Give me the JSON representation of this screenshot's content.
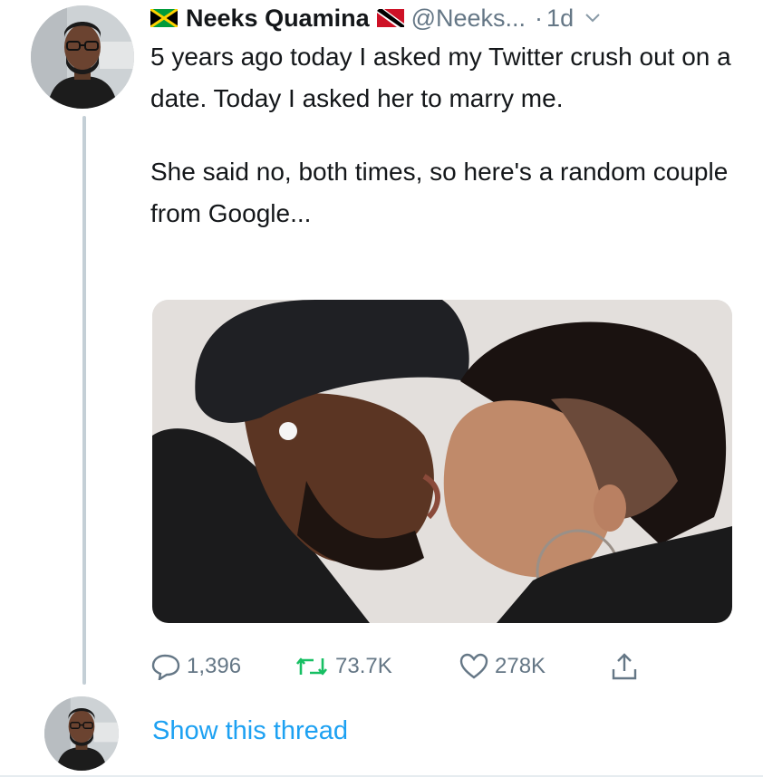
{
  "tweet": {
    "author_name": "Neeks Quamina",
    "handle": "@Neeks...",
    "dot": "·",
    "time": "1d",
    "paragraphs": [
      "5 years ago today I asked my Twitter crush out on a date. Today I asked her to marry me.",
      "She said no, both times, so here's a random couple from Google..."
    ],
    "stats": {
      "replies": "1,396",
      "retweets": "73.7K",
      "likes": "278K"
    },
    "show_thread": "Show this thread"
  },
  "icons": {
    "flag_left": "jamaica-flag-icon",
    "flag_right": "trinidad-flag-icon",
    "more": "chevron-down-icon",
    "reply": "reply-icon",
    "retweet": "retweet-icon",
    "like": "heart-icon",
    "share": "share-icon"
  },
  "colors": {
    "text": "#14171a",
    "muted": "#657786",
    "link": "#1da1f2",
    "thread_line": "#c4cfd6",
    "retweet_green": "#17bf63"
  }
}
